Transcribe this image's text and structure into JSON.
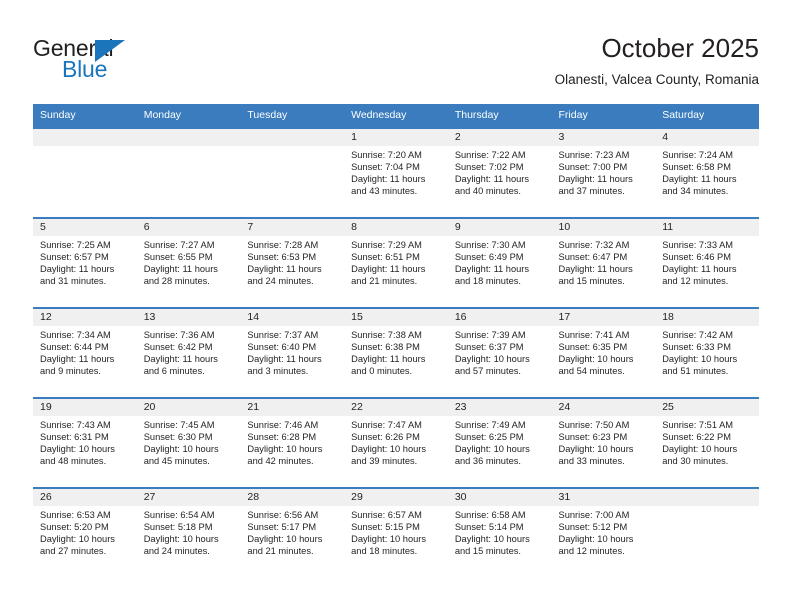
{
  "brand": {
    "name_top": "General",
    "name_bottom": "Blue",
    "logo_color": "#1b75bb",
    "triangle_icon": "triangle-icon"
  },
  "header": {
    "title": "October 2025",
    "subtitle": "Olanesti, Valcea County, Romania"
  },
  "theme": {
    "header_blue": "#3a7cbe",
    "daynum_band": "#f0f0f0",
    "text": "#231f20",
    "background": "#ffffff"
  },
  "calendar": {
    "weekday_headers": [
      "Sunday",
      "Monday",
      "Tuesday",
      "Wednesday",
      "Thursday",
      "Friday",
      "Saturday"
    ],
    "weeks": [
      [
        {
          "day": "",
          "sunrise": "",
          "sunset": "",
          "daylight_1": "",
          "daylight_2": ""
        },
        {
          "day": "",
          "sunrise": "",
          "sunset": "",
          "daylight_1": "",
          "daylight_2": ""
        },
        {
          "day": "",
          "sunrise": "",
          "sunset": "",
          "daylight_1": "",
          "daylight_2": ""
        },
        {
          "day": "1",
          "sunrise": "Sunrise: 7:20 AM",
          "sunset": "Sunset: 7:04 PM",
          "daylight_1": "Daylight: 11 hours",
          "daylight_2": "and 43 minutes."
        },
        {
          "day": "2",
          "sunrise": "Sunrise: 7:22 AM",
          "sunset": "Sunset: 7:02 PM",
          "daylight_1": "Daylight: 11 hours",
          "daylight_2": "and 40 minutes."
        },
        {
          "day": "3",
          "sunrise": "Sunrise: 7:23 AM",
          "sunset": "Sunset: 7:00 PM",
          "daylight_1": "Daylight: 11 hours",
          "daylight_2": "and 37 minutes."
        },
        {
          "day": "4",
          "sunrise": "Sunrise: 7:24 AM",
          "sunset": "Sunset: 6:58 PM",
          "daylight_1": "Daylight: 11 hours",
          "daylight_2": "and 34 minutes."
        }
      ],
      [
        {
          "day": "5",
          "sunrise": "Sunrise: 7:25 AM",
          "sunset": "Sunset: 6:57 PM",
          "daylight_1": "Daylight: 11 hours",
          "daylight_2": "and 31 minutes."
        },
        {
          "day": "6",
          "sunrise": "Sunrise: 7:27 AM",
          "sunset": "Sunset: 6:55 PM",
          "daylight_1": "Daylight: 11 hours",
          "daylight_2": "and 28 minutes."
        },
        {
          "day": "7",
          "sunrise": "Sunrise: 7:28 AM",
          "sunset": "Sunset: 6:53 PM",
          "daylight_1": "Daylight: 11 hours",
          "daylight_2": "and 24 minutes."
        },
        {
          "day": "8",
          "sunrise": "Sunrise: 7:29 AM",
          "sunset": "Sunset: 6:51 PM",
          "daylight_1": "Daylight: 11 hours",
          "daylight_2": "and 21 minutes."
        },
        {
          "day": "9",
          "sunrise": "Sunrise: 7:30 AM",
          "sunset": "Sunset: 6:49 PM",
          "daylight_1": "Daylight: 11 hours",
          "daylight_2": "and 18 minutes."
        },
        {
          "day": "10",
          "sunrise": "Sunrise: 7:32 AM",
          "sunset": "Sunset: 6:47 PM",
          "daylight_1": "Daylight: 11 hours",
          "daylight_2": "and 15 minutes."
        },
        {
          "day": "11",
          "sunrise": "Sunrise: 7:33 AM",
          "sunset": "Sunset: 6:46 PM",
          "daylight_1": "Daylight: 11 hours",
          "daylight_2": "and 12 minutes."
        }
      ],
      [
        {
          "day": "12",
          "sunrise": "Sunrise: 7:34 AM",
          "sunset": "Sunset: 6:44 PM",
          "daylight_1": "Daylight: 11 hours",
          "daylight_2": "and 9 minutes."
        },
        {
          "day": "13",
          "sunrise": "Sunrise: 7:36 AM",
          "sunset": "Sunset: 6:42 PM",
          "daylight_1": "Daylight: 11 hours",
          "daylight_2": "and 6 minutes."
        },
        {
          "day": "14",
          "sunrise": "Sunrise: 7:37 AM",
          "sunset": "Sunset: 6:40 PM",
          "daylight_1": "Daylight: 11 hours",
          "daylight_2": "and 3 minutes."
        },
        {
          "day": "15",
          "sunrise": "Sunrise: 7:38 AM",
          "sunset": "Sunset: 6:38 PM",
          "daylight_1": "Daylight: 11 hours",
          "daylight_2": "and 0 minutes."
        },
        {
          "day": "16",
          "sunrise": "Sunrise: 7:39 AM",
          "sunset": "Sunset: 6:37 PM",
          "daylight_1": "Daylight: 10 hours",
          "daylight_2": "and 57 minutes."
        },
        {
          "day": "17",
          "sunrise": "Sunrise: 7:41 AM",
          "sunset": "Sunset: 6:35 PM",
          "daylight_1": "Daylight: 10 hours",
          "daylight_2": "and 54 minutes."
        },
        {
          "day": "18",
          "sunrise": "Sunrise: 7:42 AM",
          "sunset": "Sunset: 6:33 PM",
          "daylight_1": "Daylight: 10 hours",
          "daylight_2": "and 51 minutes."
        }
      ],
      [
        {
          "day": "19",
          "sunrise": "Sunrise: 7:43 AM",
          "sunset": "Sunset: 6:31 PM",
          "daylight_1": "Daylight: 10 hours",
          "daylight_2": "and 48 minutes."
        },
        {
          "day": "20",
          "sunrise": "Sunrise: 7:45 AM",
          "sunset": "Sunset: 6:30 PM",
          "daylight_1": "Daylight: 10 hours",
          "daylight_2": "and 45 minutes."
        },
        {
          "day": "21",
          "sunrise": "Sunrise: 7:46 AM",
          "sunset": "Sunset: 6:28 PM",
          "daylight_1": "Daylight: 10 hours",
          "daylight_2": "and 42 minutes."
        },
        {
          "day": "22",
          "sunrise": "Sunrise: 7:47 AM",
          "sunset": "Sunset: 6:26 PM",
          "daylight_1": "Daylight: 10 hours",
          "daylight_2": "and 39 minutes."
        },
        {
          "day": "23",
          "sunrise": "Sunrise: 7:49 AM",
          "sunset": "Sunset: 6:25 PM",
          "daylight_1": "Daylight: 10 hours",
          "daylight_2": "and 36 minutes."
        },
        {
          "day": "24",
          "sunrise": "Sunrise: 7:50 AM",
          "sunset": "Sunset: 6:23 PM",
          "daylight_1": "Daylight: 10 hours",
          "daylight_2": "and 33 minutes."
        },
        {
          "day": "25",
          "sunrise": "Sunrise: 7:51 AM",
          "sunset": "Sunset: 6:22 PM",
          "daylight_1": "Daylight: 10 hours",
          "daylight_2": "and 30 minutes."
        }
      ],
      [
        {
          "day": "26",
          "sunrise": "Sunrise: 6:53 AM",
          "sunset": "Sunset: 5:20 PM",
          "daylight_1": "Daylight: 10 hours",
          "daylight_2": "and 27 minutes."
        },
        {
          "day": "27",
          "sunrise": "Sunrise: 6:54 AM",
          "sunset": "Sunset: 5:18 PM",
          "daylight_1": "Daylight: 10 hours",
          "daylight_2": "and 24 minutes."
        },
        {
          "day": "28",
          "sunrise": "Sunrise: 6:56 AM",
          "sunset": "Sunset: 5:17 PM",
          "daylight_1": "Daylight: 10 hours",
          "daylight_2": "and 21 minutes."
        },
        {
          "day": "29",
          "sunrise": "Sunrise: 6:57 AM",
          "sunset": "Sunset: 5:15 PM",
          "daylight_1": "Daylight: 10 hours",
          "daylight_2": "and 18 minutes."
        },
        {
          "day": "30",
          "sunrise": "Sunrise: 6:58 AM",
          "sunset": "Sunset: 5:14 PM",
          "daylight_1": "Daylight: 10 hours",
          "daylight_2": "and 15 minutes."
        },
        {
          "day": "31",
          "sunrise": "Sunrise: 7:00 AM",
          "sunset": "Sunset: 5:12 PM",
          "daylight_1": "Daylight: 10 hours",
          "daylight_2": "and 12 minutes."
        },
        {
          "day": "",
          "sunrise": "",
          "sunset": "",
          "daylight_1": "",
          "daylight_2": ""
        }
      ]
    ]
  }
}
